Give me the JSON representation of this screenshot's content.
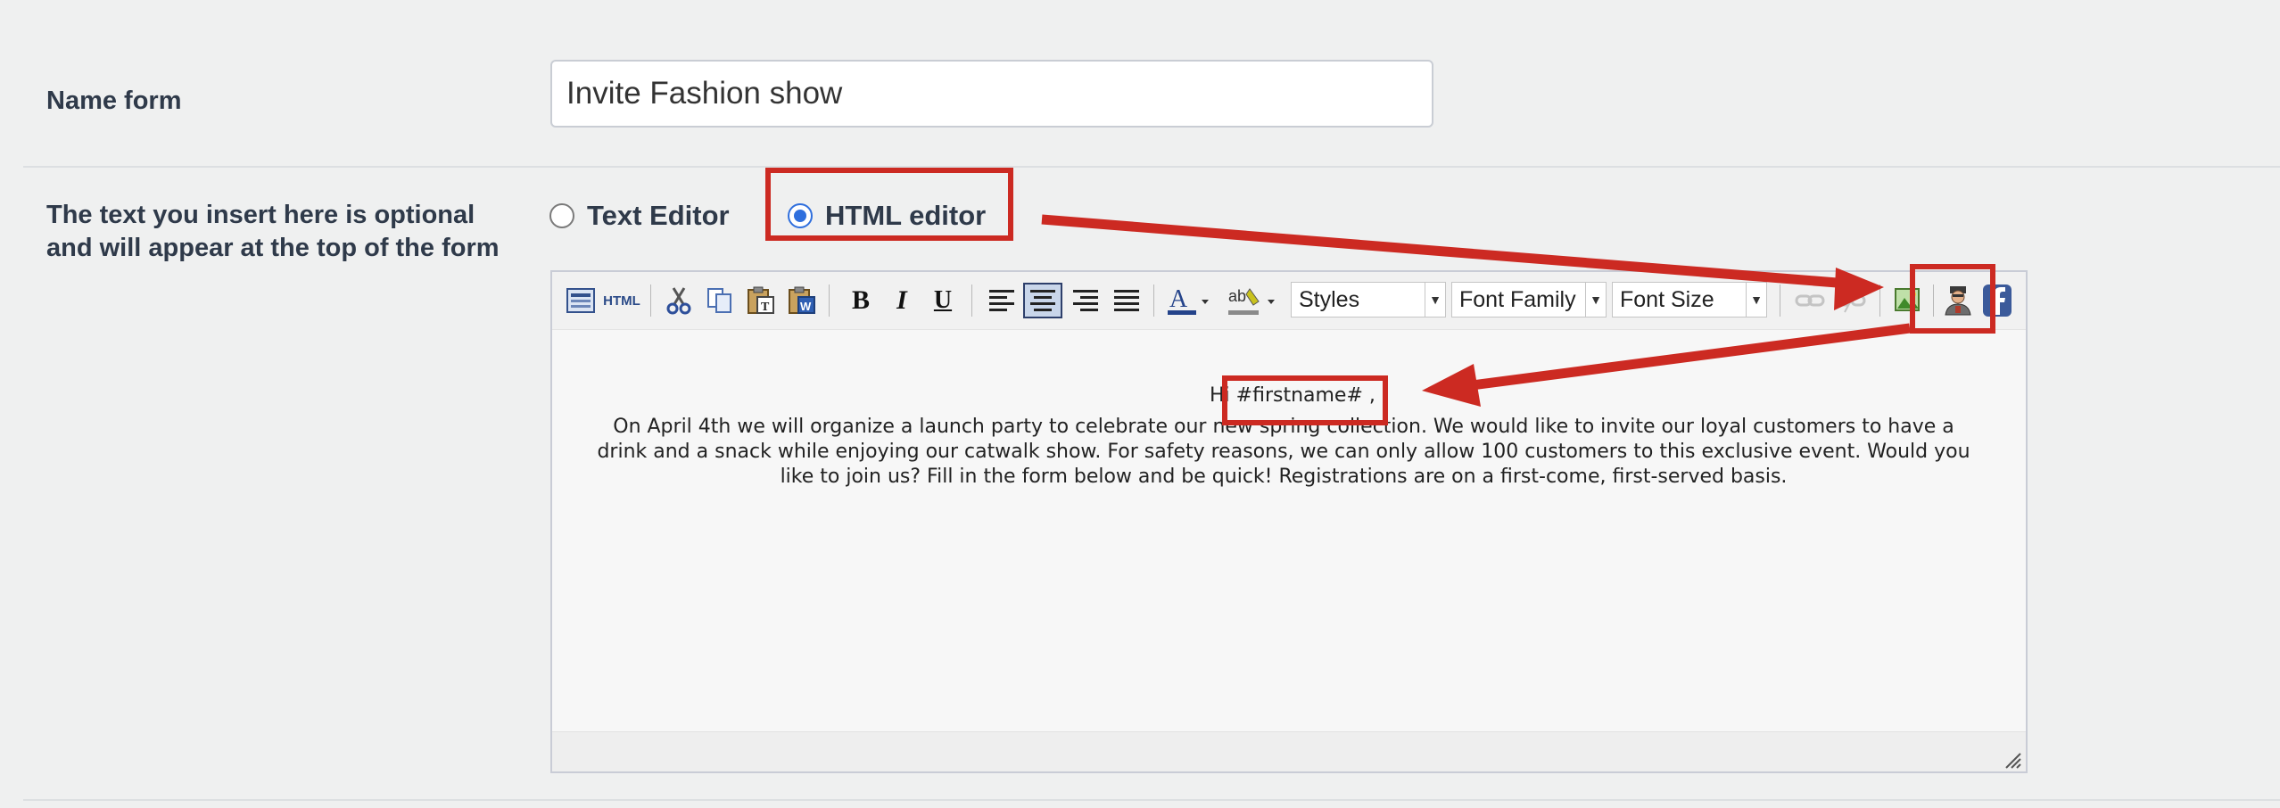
{
  "form": {
    "name_label": "Name form",
    "name_value": "Invite Fashion show",
    "desc_label": "The text you insert here is optional and will appear at the top of the form"
  },
  "editor_mode": {
    "options": [
      "Text Editor",
      "HTML editor"
    ],
    "selected": "HTML editor"
  },
  "toolbar": {
    "html_label": "HTML",
    "bold": "B",
    "italic": "I",
    "underline": "U",
    "styles": "Styles",
    "font_family": "Font Family",
    "font_size": "Font Size"
  },
  "content": {
    "greeting": "Hi",
    "placeholder": "#firstname#",
    "comma": ",",
    "body": "On April 4th we will organize a launch party to celebrate our new spring collection. We would like to invite our loyal customers to have a drink and a snack while enjoying our catwalk show. For safety reasons, we can only allow 100 customers to this exclusive event. Would you like to join us? Fill in the form below and be quick! Registrations are on a first-come, first-served basis."
  },
  "colors": {
    "annotation": "#cc2a22",
    "radio_selected": "#2f6fdd"
  }
}
